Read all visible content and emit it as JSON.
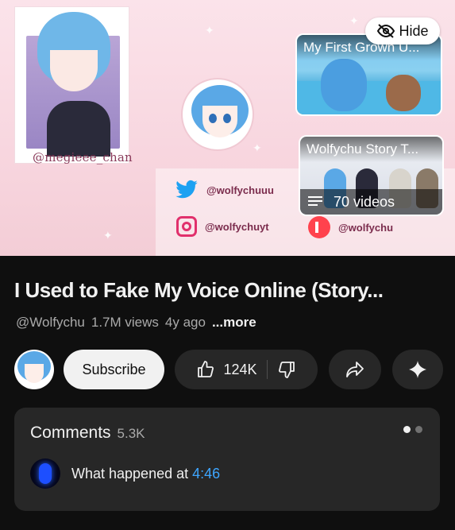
{
  "end_screen": {
    "art_handle": "@megieee_chan",
    "social": {
      "twitter": "@wolfychuuu",
      "instagram": "@wolfychuyt",
      "patreon": "@wolfychu"
    },
    "hide_label": "Hide",
    "card1_title": "My First Grown U...",
    "card2_title": "Wolfychu Story T...",
    "card2_videos": "70 videos"
  },
  "video": {
    "title": "I Used to Fake My Voice Online (Story...",
    "channel": "@Wolfychu",
    "views": "1.7M views",
    "age": "4y ago",
    "more": "...more"
  },
  "actions": {
    "subscribe": "Subscribe",
    "likes": "124K"
  },
  "comments": {
    "label": "Comments",
    "count": "5.3K",
    "preview_text": "What happened at",
    "preview_timestamp": "4:46"
  },
  "icons": [
    "eye-off-icon",
    "twitter-icon",
    "instagram-icon",
    "patreon-icon",
    "playlist-icon",
    "thumb-up-icon",
    "thumb-down-icon",
    "share-icon",
    "sparkle-icon"
  ],
  "colors": {
    "background": "#0f0f0f",
    "pill": "#272727",
    "link_blue": "#3ea6ff",
    "subscribe_bg": "#f1f1f1"
  }
}
